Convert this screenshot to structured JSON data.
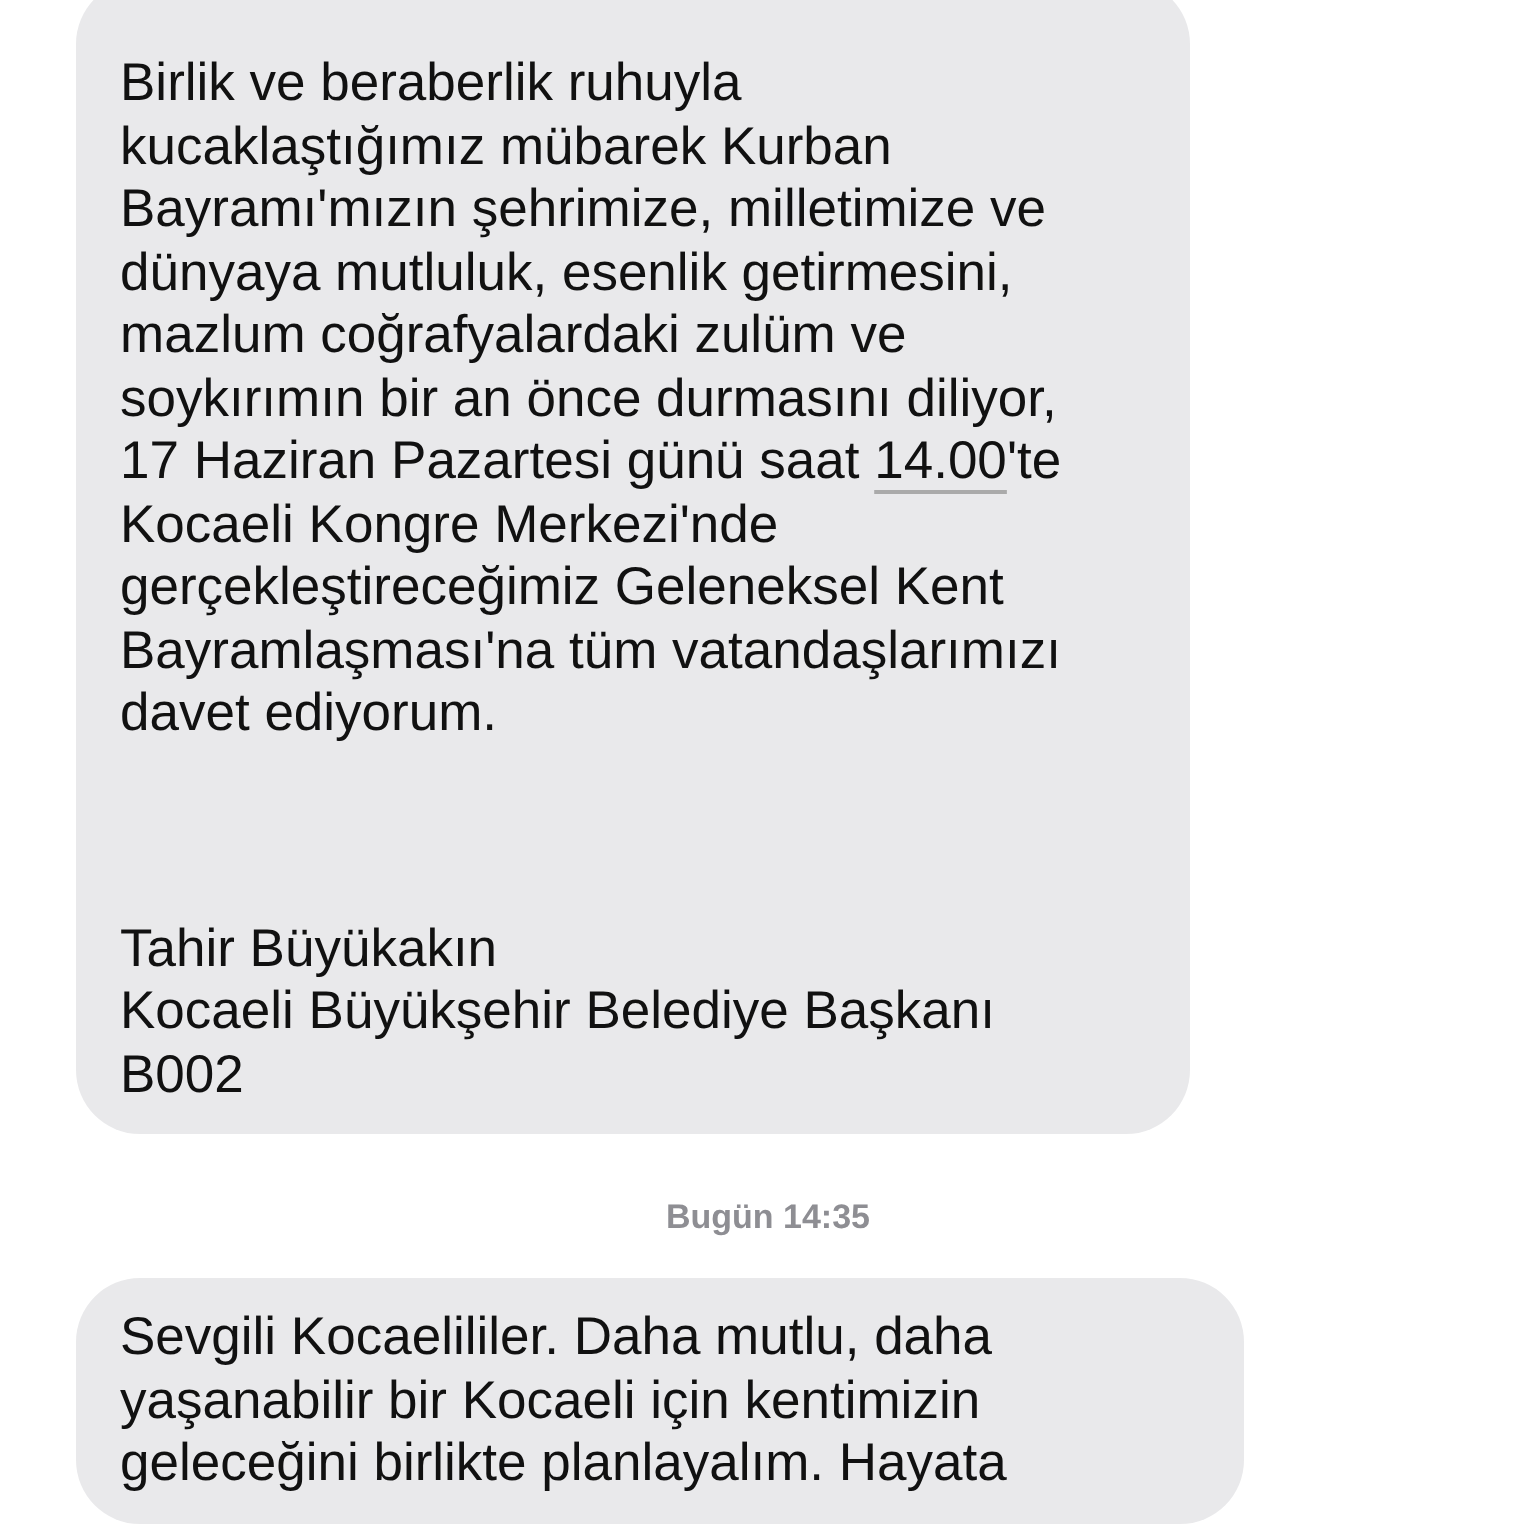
{
  "messages": [
    {
      "kind": "bubble",
      "blocks": [
        {
          "lines": [
            [
              {
                "text": "Birlik ve beraberlik ruhuyla"
              }
            ],
            [
              {
                "text": "kucaklaştığımız mübarek Kurban"
              }
            ],
            [
              {
                "text": "Bayramı'mızın şehrimize, milletimize ve"
              }
            ],
            [
              {
                "text": "dünyaya mutluluk, esenlik getirmesini,"
              }
            ],
            [
              {
                "text": "mazlum coğrafyalardaki zulüm ve"
              }
            ],
            [
              {
                "text": "soykırımın bir an önce durmasını diliyor,"
              }
            ],
            [
              {
                "text": "17 Haziran Pazartesi günü saat "
              },
              {
                "text": "14.00",
                "link": true
              },
              {
                "text": "'te"
              }
            ],
            [
              {
                "text": "Kocaeli Kongre Merkezi'nde"
              }
            ],
            [
              {
                "text": "gerçekleştireceğimiz Geleneksel Kent"
              }
            ],
            [
              {
                "text": "Bayramlaşması'na tüm vatandaşlarımızı"
              }
            ],
            [
              {
                "text": "davet ediyorum."
              }
            ]
          ]
        },
        {
          "lines": [
            [
              {
                "text": "Tahir Büyükakın"
              }
            ],
            [
              {
                "text": "Kocaeli Büyükşehir Belediye Başkanı"
              }
            ],
            [
              {
                "text": "B002"
              }
            ]
          ]
        }
      ]
    },
    {
      "kind": "timestamp",
      "text": "Bugün 14:35"
    },
    {
      "kind": "bubble",
      "blocks": [
        {
          "lines": [
            [
              {
                "text": "Sevgili Kocaelililer. Daha mutlu, daha"
              }
            ],
            [
              {
                "text": "yaşanabilir bir Kocaeli için kentimizin"
              }
            ],
            [
              {
                "text": "geleceğini birlikte planlayalım. Hayata"
              }
            ]
          ]
        }
      ]
    }
  ]
}
